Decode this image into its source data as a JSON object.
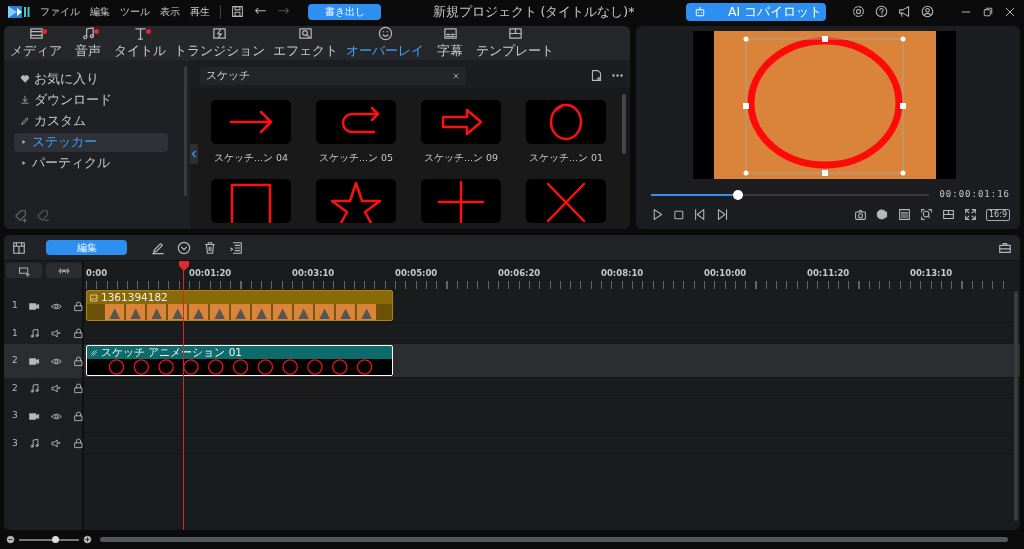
{
  "window": {
    "title": "新規プロジェクト (タイトルなし)*"
  },
  "menu": [
    "ファイル",
    "編集",
    "ツール",
    "表示",
    "再生"
  ],
  "export_button": "書き出し",
  "copilot_button": "AI コパイロット",
  "tabs": [
    {
      "kind": "media",
      "label": "メディア",
      "selected": false,
      "new": true
    },
    {
      "kind": "audio",
      "label": "音声",
      "selected": false,
      "new": true
    },
    {
      "kind": "title",
      "label": "タイトル",
      "selected": false,
      "new": true
    },
    {
      "kind": "transition",
      "label": "トランジション",
      "selected": false,
      "new": false
    },
    {
      "kind": "effect",
      "label": "エフェクト",
      "selected": false,
      "new": false
    },
    {
      "kind": "overlay",
      "label": "オーバーレイ",
      "selected": true,
      "new": false
    },
    {
      "kind": "subtitle",
      "label": "字幕",
      "selected": false,
      "new": false
    },
    {
      "kind": "template",
      "label": "テンプレート",
      "selected": false,
      "new": false
    }
  ],
  "library": {
    "categories": [
      {
        "kind": "heart",
        "label": "お気に入り",
        "selected": false
      },
      {
        "kind": "download",
        "label": "ダウンロード",
        "selected": false
      },
      {
        "kind": "pencil",
        "label": "カスタム",
        "selected": false
      },
      {
        "kind": "folder",
        "label": "ステッカー",
        "selected": true
      },
      {
        "kind": "folder",
        "label": "パーティクル",
        "selected": false
      }
    ],
    "search": {
      "value": "スケッチ"
    },
    "stickers": [
      {
        "kind": "arrow",
        "label": "スケッチ...ン 04"
      },
      {
        "kind": "u-arrow",
        "label": "スケッチ...ン 05"
      },
      {
        "kind": "block-arrow",
        "label": "スケッチ...ン 09"
      },
      {
        "kind": "circle",
        "label": "スケッチ...ン 01"
      },
      {
        "kind": "square"
      },
      {
        "kind": "star"
      },
      {
        "kind": "plus"
      },
      {
        "kind": "cross"
      }
    ]
  },
  "preview": {
    "timecode": "00:00:01:16",
    "level": 0.31,
    "aspect": "16:9"
  },
  "timeline": {
    "edit_button": "編集",
    "ruler": [
      "0:00",
      "00:01:20",
      "00:03:10",
      "00:05:00",
      "00:06:20",
      "00:08:10",
      "00:10:00",
      "00:11:20",
      "00:13:10"
    ],
    "tracks": [
      {
        "number": "1",
        "kind": "video",
        "selected": false,
        "clip": {
          "kind": "video",
          "title": "1361394182",
          "selected": false
        }
      },
      {
        "number": "1",
        "kind": "audio",
        "selected": false
      },
      {
        "number": "2",
        "kind": "video",
        "selected": true,
        "clip": {
          "kind": "sticker",
          "title": "スケッチ アニメーション 01",
          "selected": true
        }
      },
      {
        "number": "2",
        "kind": "audio",
        "selected": false
      },
      {
        "number": "3",
        "kind": "video",
        "selected": false
      },
      {
        "number": "3",
        "kind": "audio",
        "selected": false
      }
    ],
    "zoom": {
      "level": 0.6
    }
  }
}
